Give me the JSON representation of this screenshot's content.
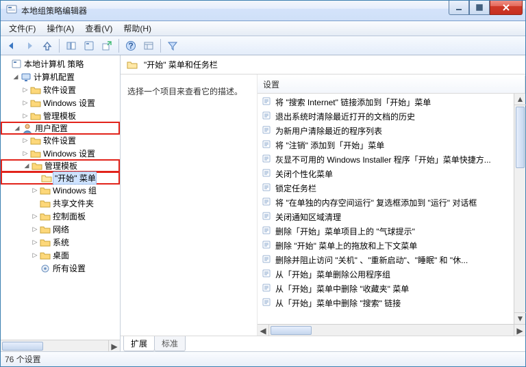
{
  "window": {
    "title": "本地组策略编辑器"
  },
  "menu": {
    "file": "文件(F)",
    "action": "操作(A)",
    "view": "查看(V)",
    "help": "帮助(H)"
  },
  "tree": {
    "root": "本地计算机 策略",
    "computer": "计算机配置",
    "c_software": "软件设置",
    "c_windows": "Windows 设置",
    "c_admin": "管理模板",
    "user": "用户配置",
    "u_software": "软件设置",
    "u_windows": "Windows 设置",
    "u_admin": "管理模板",
    "start_menu": "\"开始\" 菜单",
    "windows_comp": "Windows 组",
    "shared": "共享文件夹",
    "control_panel": "控制面板",
    "network": "网络",
    "system": "系统",
    "desktop": "桌面",
    "all_settings": "所有设置"
  },
  "right": {
    "title": "\"开始\" 菜单和任务栏",
    "desc_prompt": "选择一个项目来查看它的描述。",
    "col_setting": "设置",
    "items": [
      "将 \"搜索 Internet\" 链接添加到「开始」菜单",
      "退出系统时清除最近打开的文档的历史",
      "为新用户清除最近的程序列表",
      "将 \"注销\" 添加到「开始」菜单",
      "灰显不可用的 Windows Installer 程序「开始」菜单快捷方...",
      "关闭个性化菜单",
      "锁定任务栏",
      "将 \"在单独的内存空间运行\" 复选框添加到 \"运行\" 对话框",
      "关闭通知区域清理",
      "删除「开始」菜单项目上的 \"气球提示\"",
      "删除 \"开始\" 菜单上的拖放和上下文菜单",
      "删除并阻止访问 \"关机\" 、\"重新启动\"、\"睡眠\" 和 \"休...",
      "从「开始」菜单删除公用程序组",
      "从「开始」菜单中删除 \"收藏夹\" 菜单",
      "从「开始」菜单中删除 \"搜索\" 链接"
    ]
  },
  "tabs": {
    "extended": "扩展",
    "standard": "标准"
  },
  "status": {
    "count": "76 个设置"
  }
}
